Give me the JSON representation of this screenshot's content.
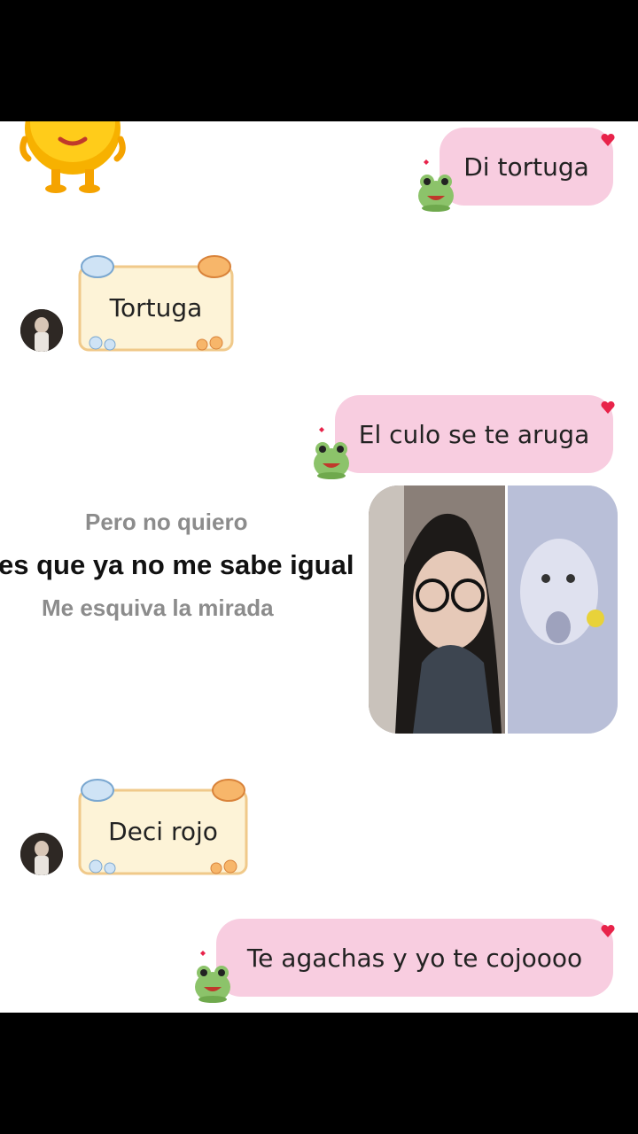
{
  "messages": [
    {
      "side": "outgoing",
      "text": "Di tortuga"
    },
    {
      "side": "incoming",
      "text": "Tortuga"
    },
    {
      "side": "outgoing",
      "text": "El culo se te aruga"
    },
    {
      "side": "incoming",
      "text": "Deci rojo"
    },
    {
      "side": "outgoing",
      "text": "Te agachas y yo te cojoooo"
    }
  ],
  "lyrics": {
    "line1": "Pero no quiero",
    "line2": "es que ya no me sabe igual",
    "line3": "Me esquiva la mirada"
  },
  "colors": {
    "outgoing_bubble": "#f8cde0",
    "note_paper": "#fdf3d7",
    "heart": "#e8234a",
    "frog": "#8cc36a"
  }
}
